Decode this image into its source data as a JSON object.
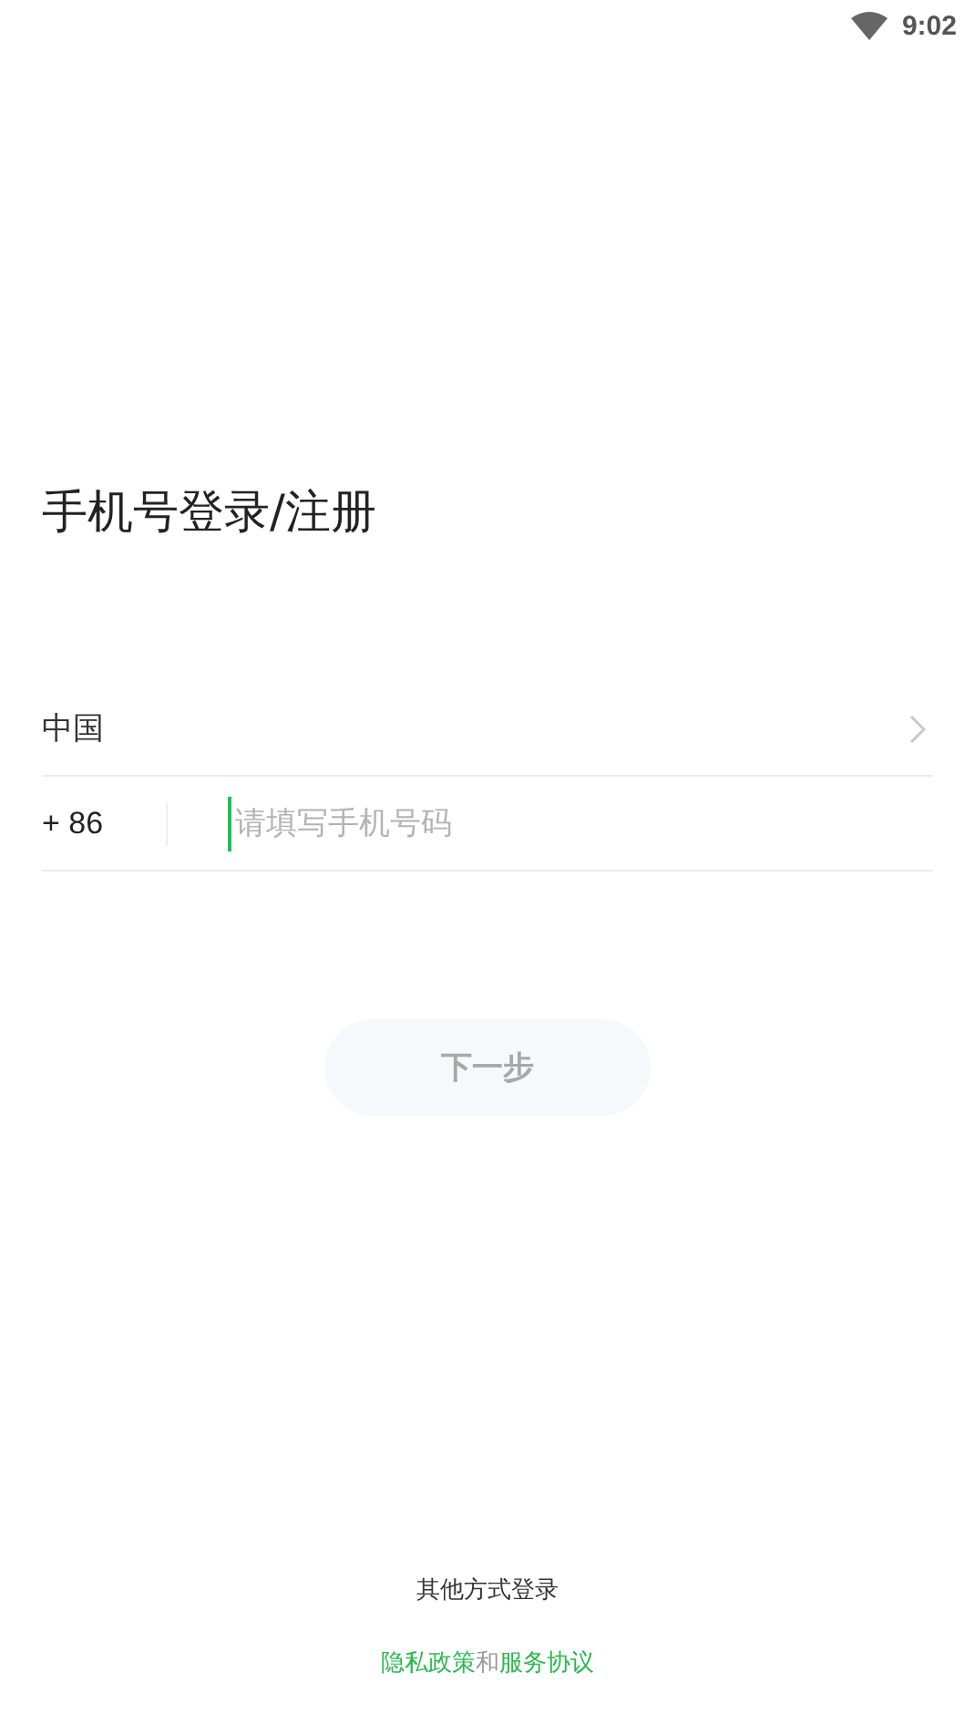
{
  "status_bar": {
    "time": "9:02"
  },
  "title": "手机号登录/注册",
  "country": {
    "name": "中国"
  },
  "phone": {
    "code": "+ 86",
    "placeholder": "请填写手机号码",
    "focused": true
  },
  "next_button": {
    "label": "下一步",
    "disabled": true
  },
  "other_login": "其他方式登录",
  "agreement": {
    "privacy": "隐私政策",
    "joiner": "和",
    "terms": "服务协议"
  }
}
